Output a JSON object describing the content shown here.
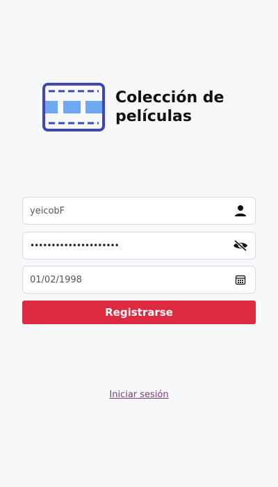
{
  "brand": {
    "title": "Colección de películas",
    "logo_icon": "film-strip-icon",
    "logo_colors": {
      "frame": "#3f47b8",
      "cells": "#6fa8f2"
    }
  },
  "form": {
    "username": {
      "value": "yeicobF",
      "icon": "user-icon"
    },
    "password": {
      "value": "•••••••••••••••••••••",
      "icon": "eye-slash-icon"
    },
    "birthdate": {
      "value": "01/02/1998",
      "icon": "calendar-icon"
    },
    "submit_label": "Registrarse"
  },
  "footer": {
    "login_link": "Iniciar sesión"
  },
  "colors": {
    "accent": "#dc2b41",
    "link": "#7b3b7d",
    "background": "#f7f8fa"
  }
}
